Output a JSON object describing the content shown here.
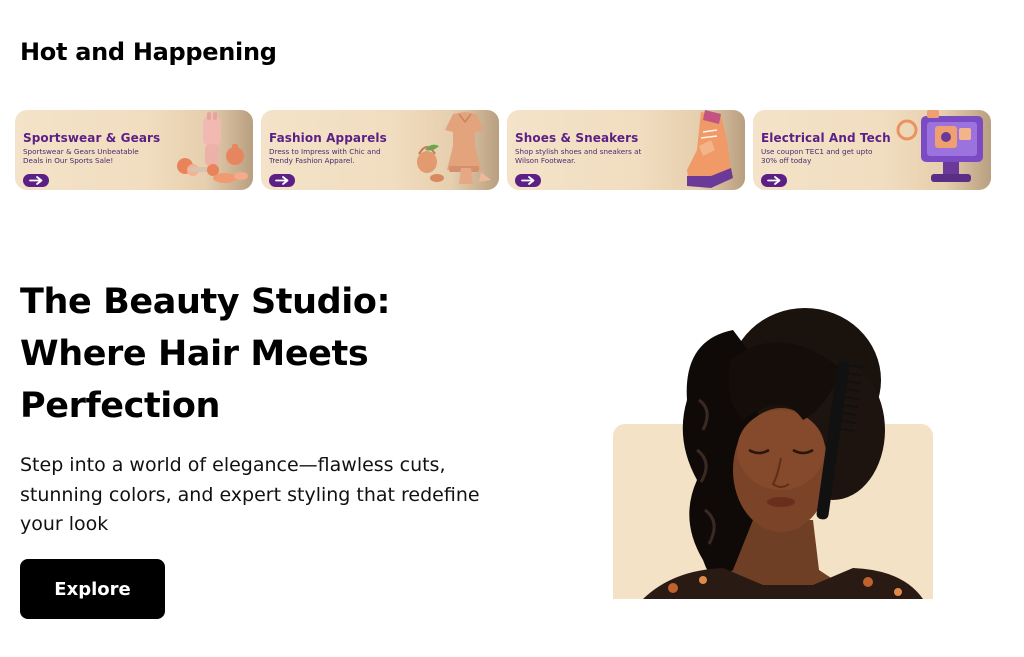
{
  "section": {
    "title": "Hot and Happening"
  },
  "banners": [
    {
      "title": "Sportswear & Gears",
      "description": "Sportswear & Gears Unbeatable Deals in Our Sports Sale!",
      "icon": "sports-gear-icon"
    },
    {
      "title": "Fashion Apparels",
      "description": "Dress to Impress with Chic and Trendy Fashion Apparel.",
      "icon": "fashion-apparel-icon"
    },
    {
      "title": "Shoes & Sneakers",
      "description": "Shop stylish shoes and sneakers at Wilson Footwear.",
      "icon": "sneaker-icon"
    },
    {
      "title": "Electrical And Tech",
      "description": "Use coupon TEC1 and get upto 30% off today",
      "icon": "tech-monitor-icon"
    }
  ],
  "hero": {
    "title": "The Beauty Studio: Where Hair Meets Perfection",
    "description": "Step into a world of elegance—flawless cuts, stunning colors, and expert styling that redefine your look",
    "button_label": "Explore"
  },
  "colors": {
    "banner_bg": "#f4e3c9",
    "banner_text": "#5b1f86",
    "button_bg": "#000000",
    "hero_panel": "#f3e2c5"
  }
}
